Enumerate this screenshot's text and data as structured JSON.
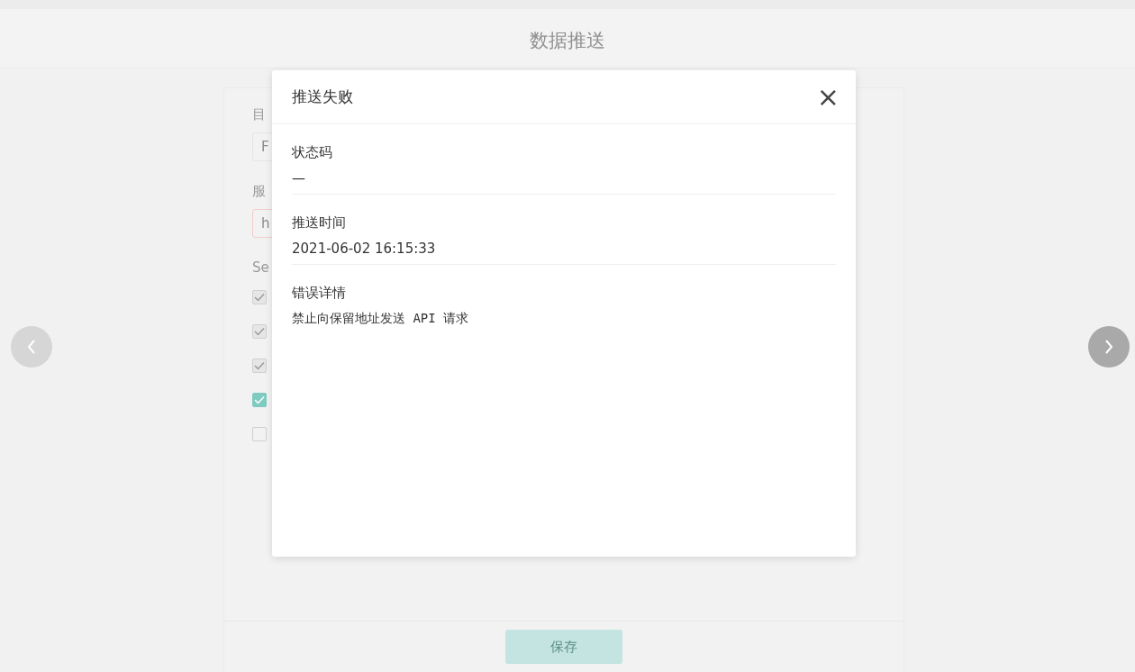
{
  "page": {
    "title": "数据推送"
  },
  "form": {
    "fields": [
      {
        "label": "目",
        "value": "F",
        "invalid": false
      },
      {
        "label": "服",
        "value": "h",
        "invalid": true
      }
    ],
    "section_label": "Se",
    "options": [
      {
        "checked": true,
        "disabled": true
      },
      {
        "checked": true,
        "disabled": true
      },
      {
        "checked": true,
        "disabled": true
      },
      {
        "checked": true,
        "disabled": false
      },
      {
        "checked": false,
        "disabled": false
      }
    ]
  },
  "save_button": {
    "label": "保存",
    "disabled": true
  },
  "dialog": {
    "title": "推送失败",
    "close": "×",
    "fields": [
      {
        "label": "状态码",
        "value": "—",
        "kind": "text"
      },
      {
        "label": "推送时间",
        "value": "2021-06-02 16:15:33",
        "kind": "text"
      },
      {
        "label": "错误详情",
        "value": "禁止向保留地址发送 API 请求",
        "kind": "code"
      }
    ]
  }
}
